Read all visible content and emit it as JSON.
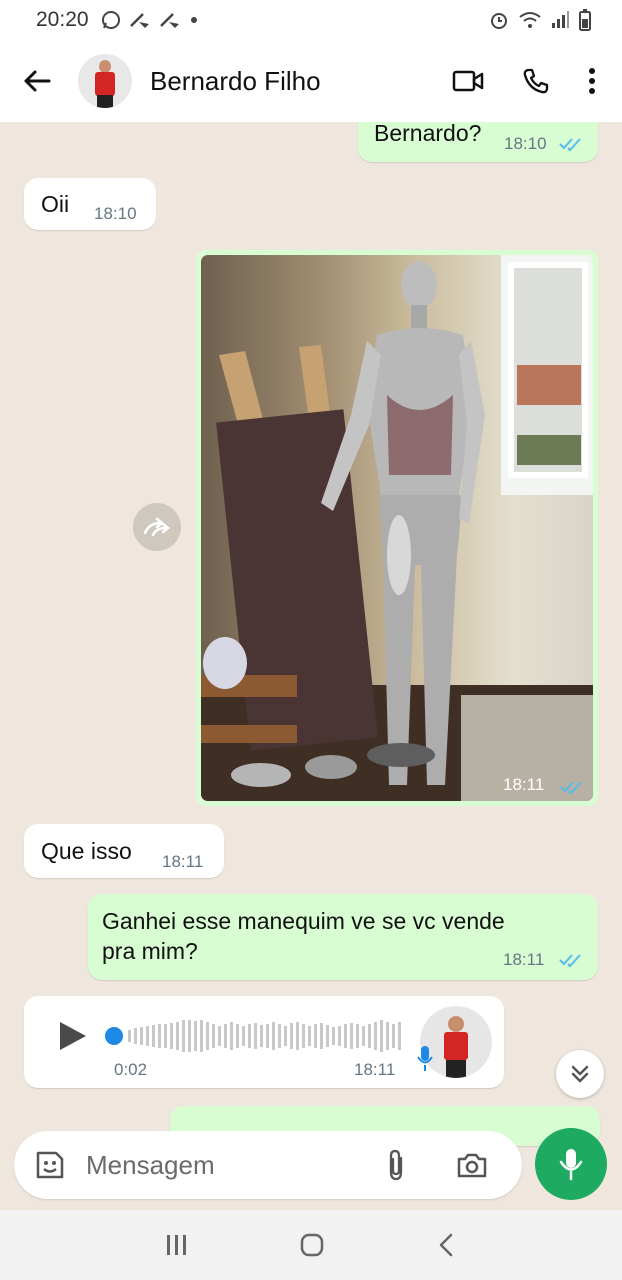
{
  "status_bar": {
    "time": "20:20",
    "icons": [
      "whatsapp-icon",
      "broom-icon",
      "broom-icon",
      "dot-icon",
      "alarm-icon",
      "wifi-icon",
      "signal-icon",
      "battery-icon"
    ]
  },
  "header": {
    "contact_name": "Bernardo Filho",
    "icons": [
      "back-arrow-icon",
      "video-call-icon",
      "phone-icon",
      "more-icon"
    ]
  },
  "messages": [
    {
      "type": "text",
      "direction": "out",
      "text": "Bernardo?",
      "time": "18:10",
      "status": "read"
    },
    {
      "type": "text",
      "direction": "in",
      "text": "Oii",
      "time": "18:10"
    },
    {
      "type": "image",
      "direction": "out",
      "time": "18:11",
      "status": "read"
    },
    {
      "type": "text",
      "direction": "in",
      "text": "Que isso",
      "time": "18:11"
    },
    {
      "type": "text",
      "direction": "out",
      "text": "Ganhei esse manequim ve se vc vende pra mim?",
      "time": "18:11",
      "status": "read"
    },
    {
      "type": "audio",
      "direction": "in",
      "duration": "0:02",
      "time": "18:11"
    }
  ],
  "input": {
    "placeholder": "Mensagem",
    "icons": [
      "sticker-icon",
      "attach-icon",
      "camera-icon",
      "mic-icon"
    ]
  },
  "colors": {
    "outgoing_bubble": "#d9fdd3",
    "incoming_bubble": "#ffffff",
    "accent_green": "#1eaa61",
    "read_ticks": "#53bdeb",
    "chat_background": "#efe7dd"
  },
  "nav_bar": {
    "icons": [
      "recents-icon",
      "home-icon",
      "back-icon"
    ]
  }
}
